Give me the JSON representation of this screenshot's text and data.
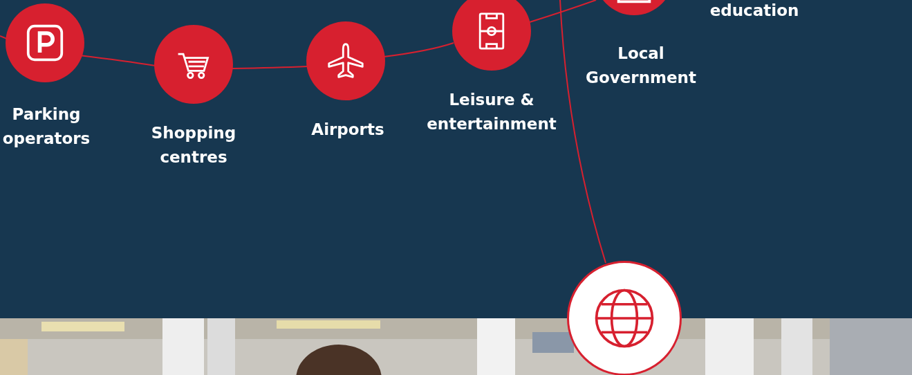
{
  "sectors": [
    {
      "label": "Parking operators"
    },
    {
      "label": "Shopping centres"
    },
    {
      "label": "Airports"
    },
    {
      "label": "Leisure & entertainment"
    },
    {
      "label": "Local Government"
    },
    {
      "label": "education"
    }
  ]
}
